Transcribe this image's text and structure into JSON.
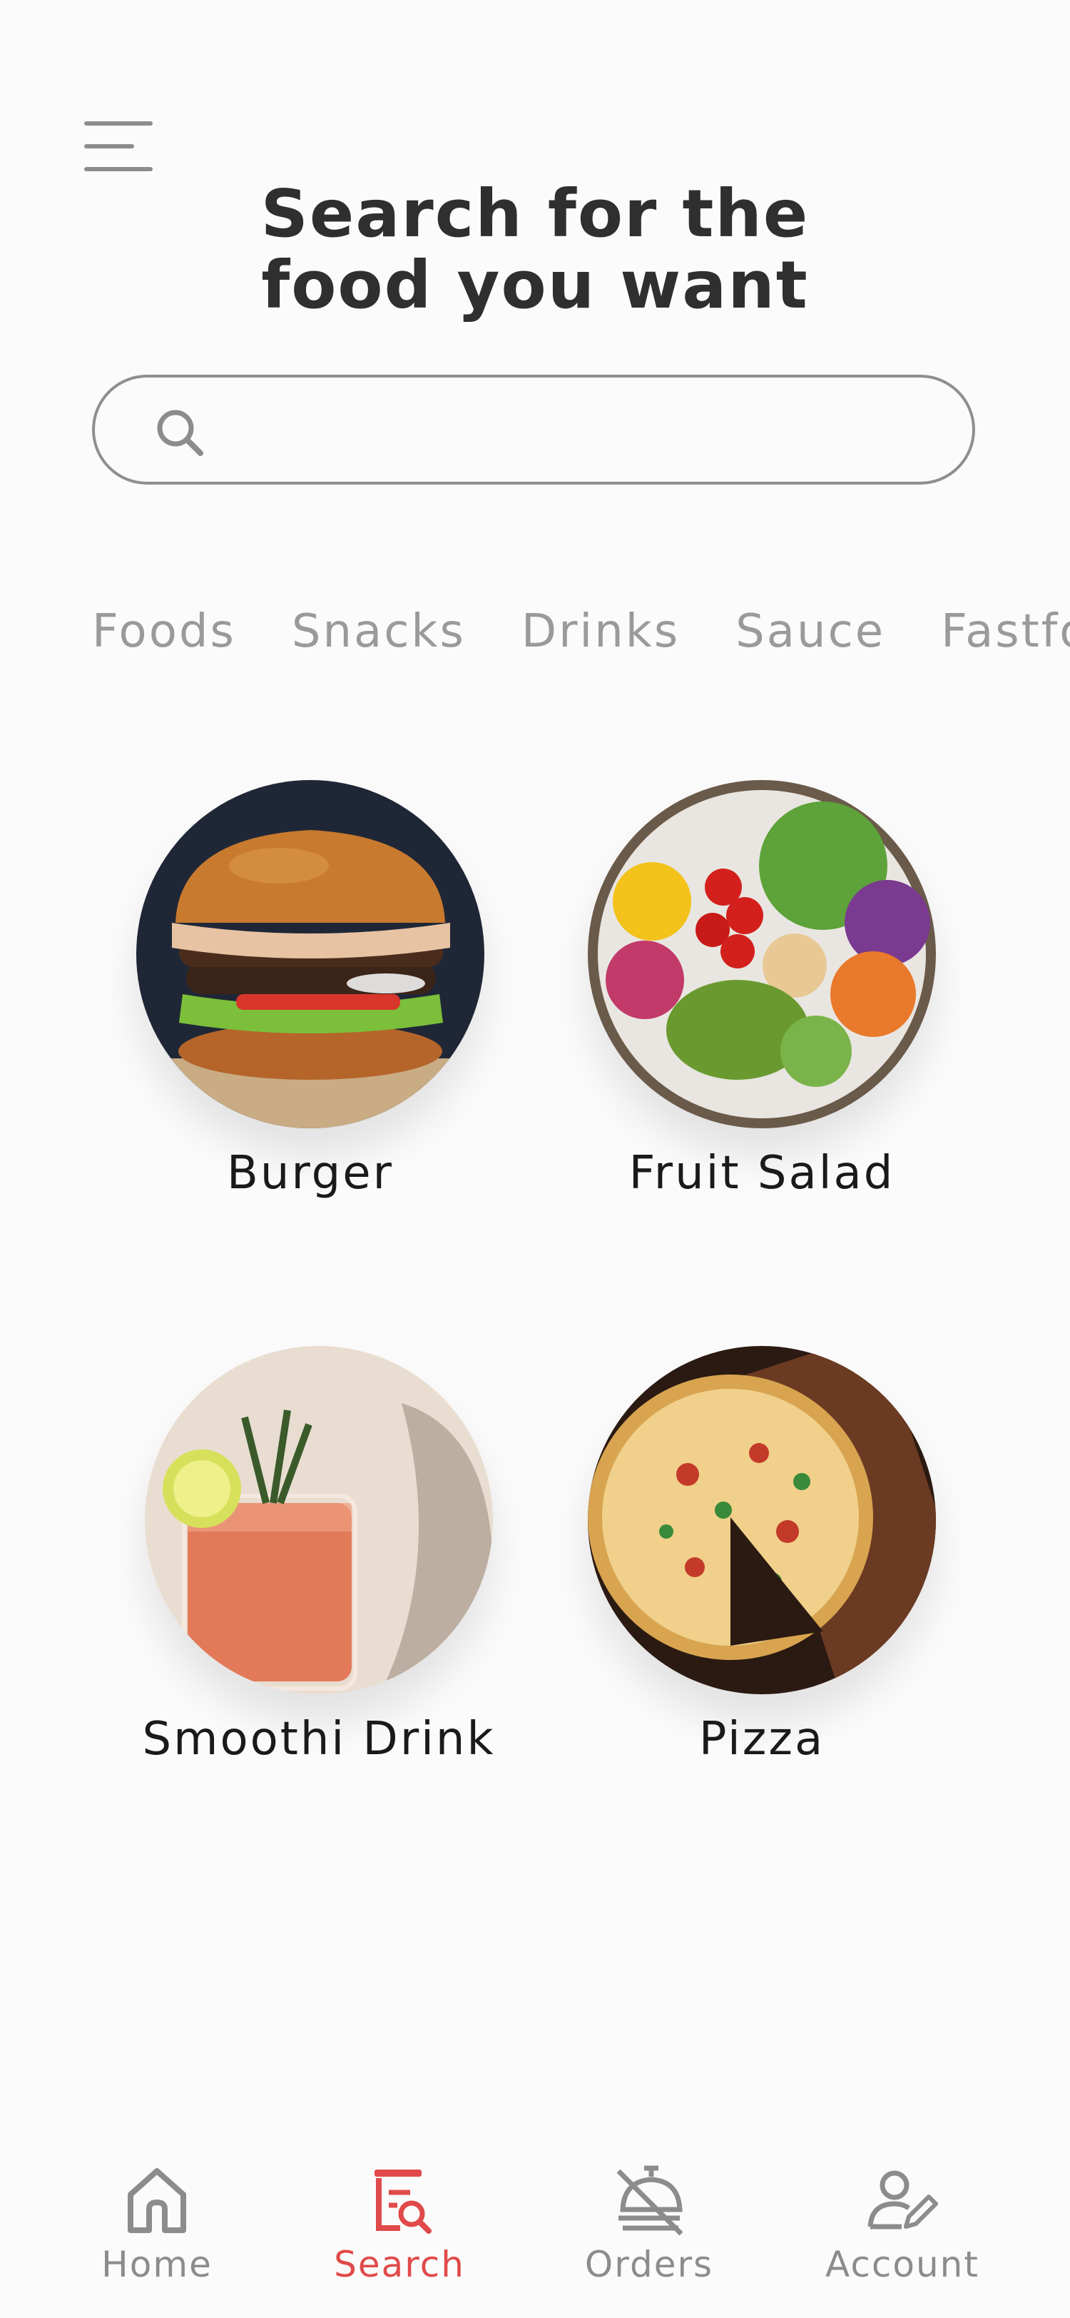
{
  "header": {
    "title_line1": "Search for the",
    "title_line2": "food you want"
  },
  "search": {
    "value": "",
    "placeholder": ""
  },
  "categories": [
    "Foods",
    "Snacks",
    "Drinks",
    "Sauce",
    "Fastfood"
  ],
  "items": [
    {
      "name": "Burger",
      "image": "burger-photo"
    },
    {
      "name": "Fruit Salad",
      "image": "salad-bowl-photo"
    },
    {
      "name": "Smoothi Drink",
      "image": "drink-glass-photo"
    },
    {
      "name": "Pizza",
      "image": "pizza-photo"
    }
  ],
  "nav": {
    "home": "Home",
    "search": "Search",
    "orders": "Orders",
    "account": "Account",
    "active": "Search"
  },
  "colors": {
    "accent": "#e04a4a",
    "muted": "#8c8c8c",
    "text": "#2f2f2f",
    "background": "#fcfbfb"
  }
}
